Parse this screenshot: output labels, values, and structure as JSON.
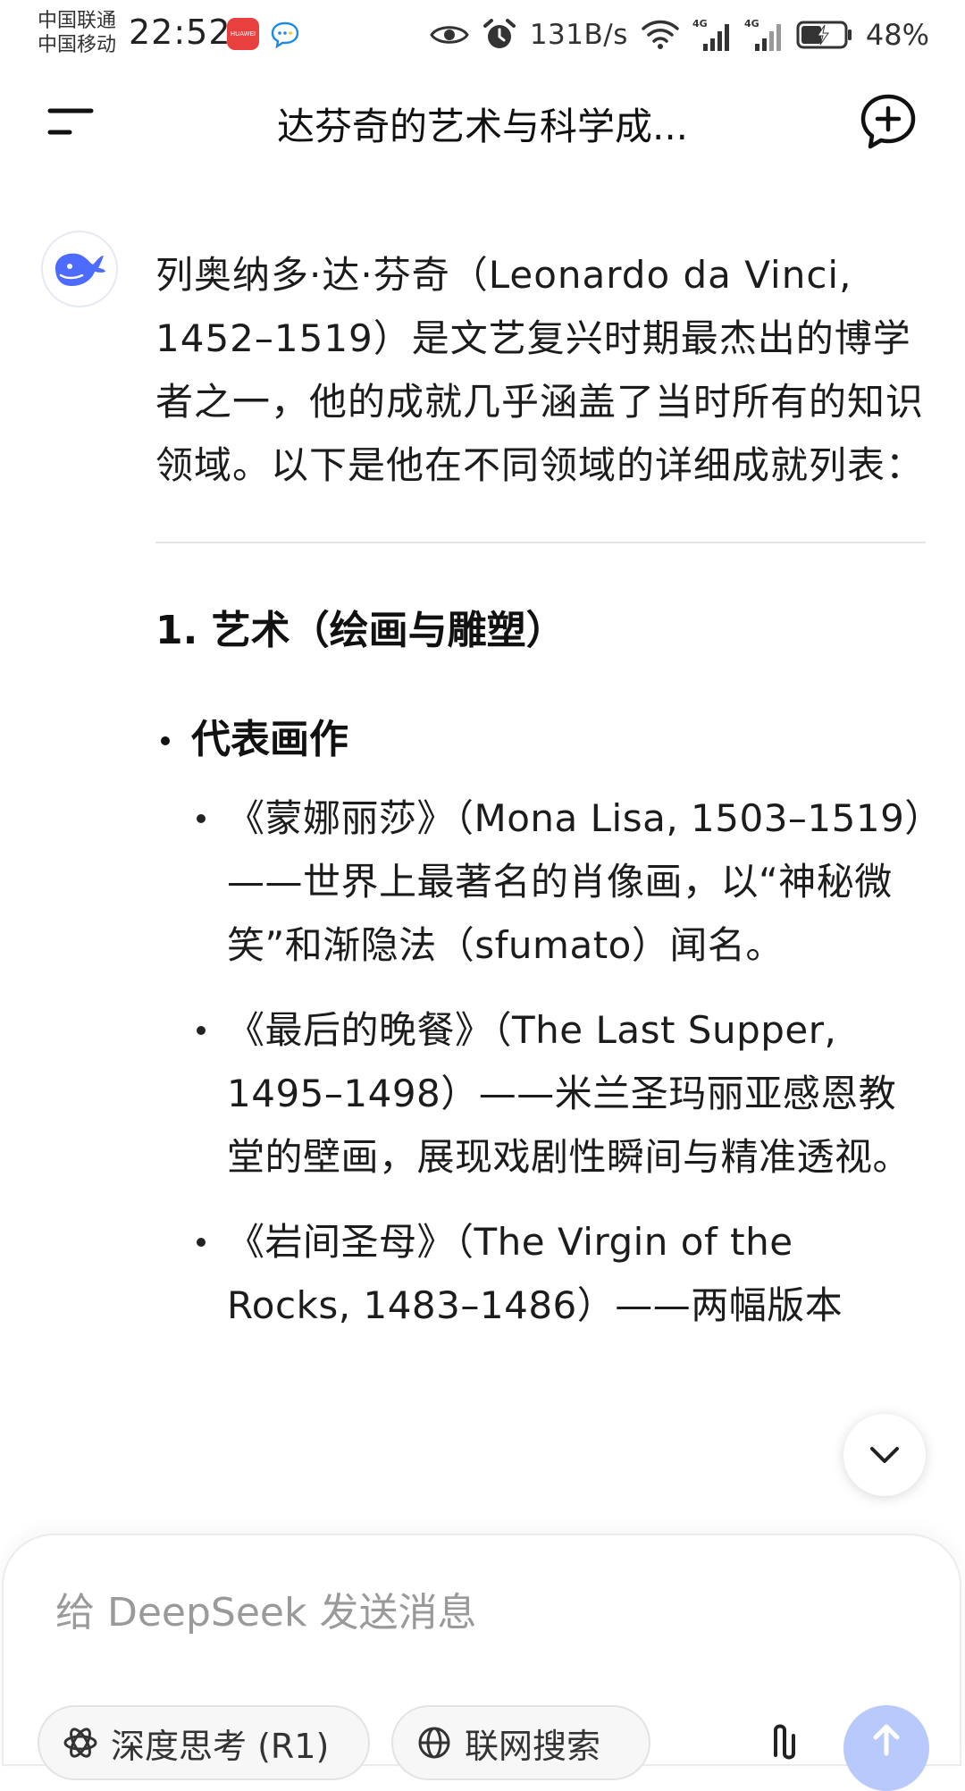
{
  "status_bar": {
    "carrier_1": "中国联通",
    "carrier_2": "中国移动",
    "time": "22:52",
    "app_badge": "HUAWEI",
    "network_speed": "131B/s",
    "network_type_1": "4G",
    "network_type_2": "4G",
    "battery_percent": "48%",
    "battery_level": 0.48
  },
  "header": {
    "title": "达芬奇的艺术与科学成..."
  },
  "message": {
    "intro": "列奥纳多·达·芬奇（Leonardo da Vinci, 1452–1519）是文艺复兴时期最杰出的博学者之一，他的成就几乎涵盖了当时所有的知识领域。以下是他在不同领域的详细成就列表：",
    "section_1_heading": "1. 艺术（绘画与雕塑）",
    "subsection_heading": "代表画作",
    "works": [
      "《蒙娜丽莎》（Mona Lisa, 1503–1519）——世界上最著名的肖像画，以“神秘微笑”和渐隐法（sfumato）闻名。",
      "《最后的晚餐》（The Last Supper, 1495–1498）——米兰圣玛丽亚感恩教堂的壁画，展现戏剧性瞬间与精准透视。",
      "《岩间圣母》（The Virgin of the Rocks, 1483–1486）——两幅版本"
    ]
  },
  "composer": {
    "placeholder": "给 DeepSeek 发送消息",
    "deep_think_label": "深度思考 (R1)",
    "web_search_label": "联网搜索"
  },
  "colors": {
    "accent": "#4d6bfe",
    "send_button": "#b8c9fb",
    "divider": "#e5e5e5",
    "placeholder": "#9a9a9a"
  }
}
